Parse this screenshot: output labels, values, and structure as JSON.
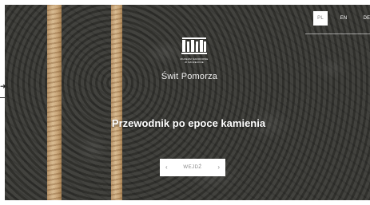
{
  "languages": [
    {
      "code": "PL",
      "active": true
    },
    {
      "code": "EN",
      "active": false
    },
    {
      "code": "DE",
      "active": false
    }
  ],
  "logo": {
    "line1": "MUZEUM NARODOWE",
    "line2": "W SZCZECINIE"
  },
  "subtitle": "Świt Pomorza",
  "title": "Przewodnik po epoce kamienia",
  "enter_button": {
    "label": "WEJDŹ"
  },
  "colors": {
    "accent_stone": "#3a3a36",
    "stripe": "#d8bb92",
    "text": "#ffffff"
  }
}
